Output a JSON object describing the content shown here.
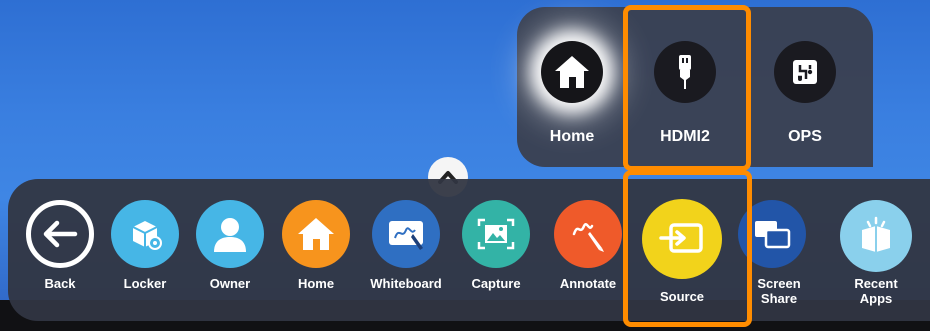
{
  "source_menu": {
    "items": [
      {
        "label": "Home",
        "icon": "home-icon"
      },
      {
        "label": "HDMI2",
        "icon": "hdmi-icon"
      },
      {
        "label": "OPS",
        "icon": "ops-icon"
      }
    ]
  },
  "dock": {
    "items": [
      {
        "label": "Back",
        "icon": "back-arrow-icon",
        "color": "#ffffff"
      },
      {
        "label": "Locker",
        "icon": "locker-icon",
        "color": "#46b6e6"
      },
      {
        "label": "Owner",
        "icon": "owner-icon",
        "color": "#46b6e6"
      },
      {
        "label": "Home",
        "icon": "home-icon",
        "color": "#f7941d"
      },
      {
        "label": "Whiteboard",
        "icon": "whiteboard-icon",
        "color": "#2f6fc2"
      },
      {
        "label": "Capture",
        "icon": "capture-icon",
        "color": "#33b3a6"
      },
      {
        "label": "Annotate",
        "icon": "annotate-icon",
        "color": "#ef5a2a"
      },
      {
        "label": "Source",
        "icon": "source-icon",
        "color": "#f2d31b"
      },
      {
        "label": "Screen Share",
        "icon": "screen-share-icon",
        "color": "#2255a8"
      },
      {
        "label": "Recent Apps",
        "icon": "recent-apps-icon",
        "color": "#8ad0ec"
      }
    ]
  },
  "colors": {
    "highlight": "#ff8c00",
    "desktop": "#3a7fe0",
    "panel": "#3a3e4c"
  }
}
